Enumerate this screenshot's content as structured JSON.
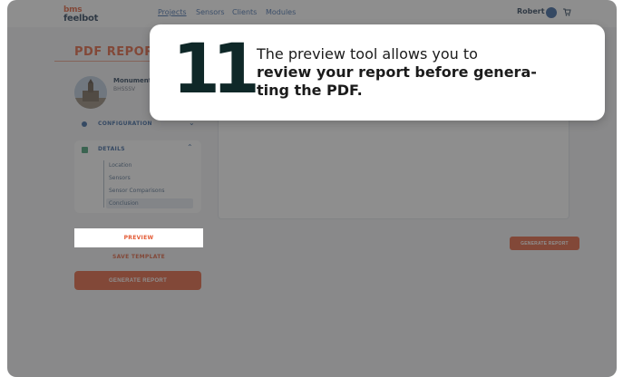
{
  "topnav": {
    "logo_line1": "bms",
    "logo_line2": "feelbot",
    "links": [
      "Projects",
      "Sensors",
      "Clients",
      "Modules"
    ],
    "user_name": "Robert"
  },
  "sidebar": {
    "title": "PDF REPORT",
    "monument_name": "Monument I",
    "monument_code": "BHSSSV",
    "configuration_label": "CONFIGURATION",
    "details_label": "DETAILS",
    "detail_items": [
      "Location",
      "Sensors",
      "Sensor Comparisons",
      "Conclusion"
    ],
    "preview_label": "PREVIEW",
    "save_template_label": "SAVE TEMPLATE",
    "generate_label": "GENERATE REPORT"
  },
  "main": {
    "generate_label": "GENERATE REPORT"
  },
  "tooltip": {
    "step_number": "11",
    "line1": "The preview tool allows you to",
    "line2": "review your report before genera-",
    "line3": "ting the PDF."
  },
  "colors": {
    "accent": "#e35a34",
    "navy": "#1e3550",
    "link_blue": "#3b68a8"
  }
}
